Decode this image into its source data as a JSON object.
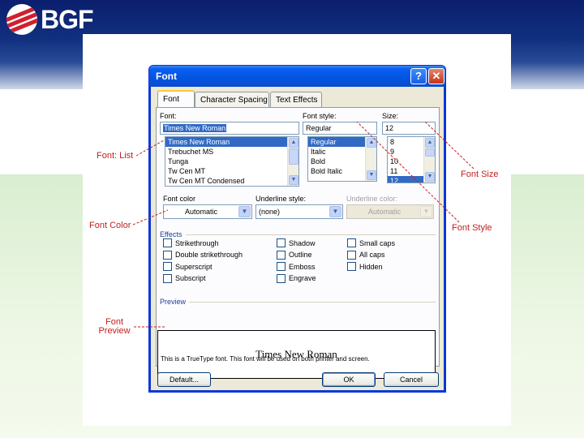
{
  "brand": {
    "logo_text": "BGF"
  },
  "dialog": {
    "title": "Font",
    "help_btn": "?",
    "close_btn": "✕",
    "tabs": [
      "Font",
      "Character Spacing",
      "Text Effects"
    ],
    "font": {
      "label": "Font:",
      "value": "Times New Roman",
      "items": [
        "Times New Roman",
        "Trebuchet MS",
        "Tunga",
        "Tw Cen MT",
        "Tw Cen MT Condensed"
      ],
      "selected": 0
    },
    "style": {
      "label": "Font style:",
      "value": "Regular",
      "items": [
        "Regular",
        "Italic",
        "Bold",
        "Bold Italic"
      ],
      "selected": 0
    },
    "size": {
      "label": "Size:",
      "value": "12",
      "items": [
        "8",
        "9",
        "10",
        "11",
        "12"
      ],
      "selected": 4
    },
    "font_color": {
      "label": "Font color",
      "value": "Automatic"
    },
    "underline_style": {
      "label": "Underline style:",
      "value": "(none)"
    },
    "underline_color": {
      "label": "Underline color:",
      "value": "Automatic"
    },
    "effects": {
      "label": "Effects",
      "col1": [
        "Strikethrough",
        "Double strikethrough",
        "Superscript",
        "Subscript"
      ],
      "col2": [
        "Shadow",
        "Outline",
        "Emboss",
        "Engrave"
      ],
      "col3": [
        "Small caps",
        "All caps",
        "Hidden"
      ]
    },
    "preview": {
      "label": "Preview",
      "text": "Times New Roman",
      "note": "This is a TrueType font. This font will be used on both printer and screen."
    },
    "buttons": {
      "default": "Default...",
      "ok": "OK",
      "cancel": "Cancel"
    }
  },
  "callouts": {
    "font_list": "Font: List",
    "font_color": "Font Color",
    "font_preview_1": "Font",
    "font_preview_2": "Preview",
    "font_size": "Font Size",
    "font_style": "Font Style"
  },
  "colors": {
    "callout": "#c41e1e",
    "title_blue": "#0454e0",
    "header_navy": "#0b1f6e"
  }
}
